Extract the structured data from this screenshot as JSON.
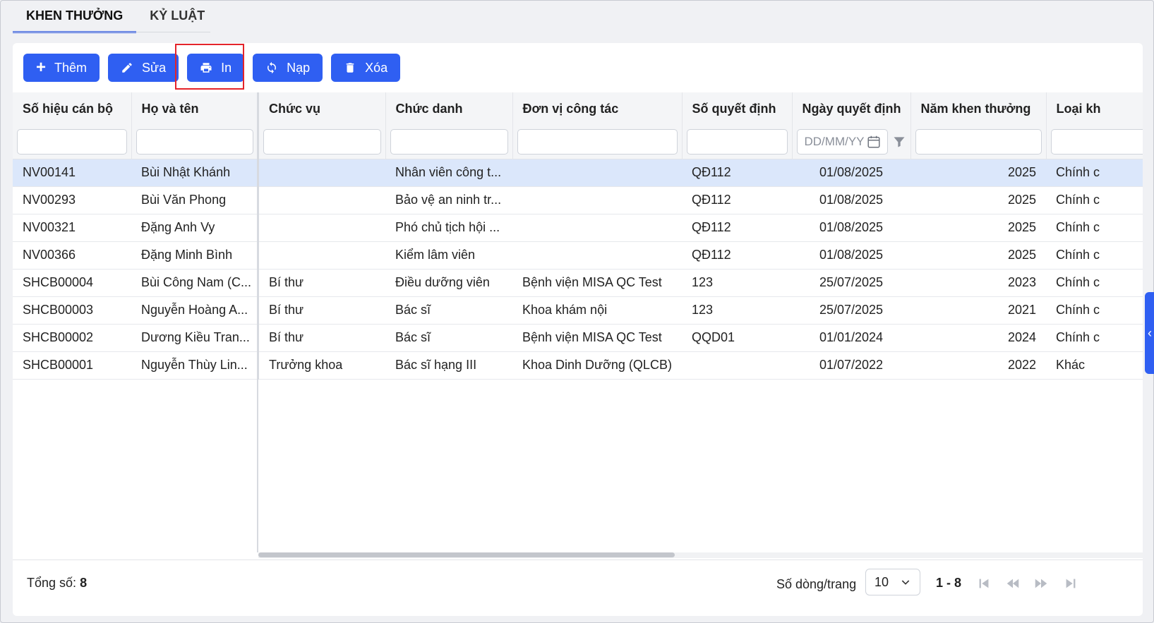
{
  "tabs": [
    {
      "label": "KHEN THƯỞNG"
    },
    {
      "label": "KỶ LUẬT"
    }
  ],
  "toolbar": {
    "add_label": "Thêm",
    "edit_label": "Sửa",
    "print_label": "In",
    "reload_label": "Nạp",
    "delete_label": "Xóa"
  },
  "columns": [
    "Số hiệu cán bộ",
    "Họ và tên",
    "Chức vụ",
    "Chức danh",
    "Đơn vị công tác",
    "Số quyết định",
    "Ngày quyết định",
    "Năm khen thưởng",
    "Loại kh"
  ],
  "filters": {
    "date_placeholder": "DD/MM/YY"
  },
  "rows": [
    {
      "code": "NV00141",
      "name": "Bùi Nhật Khánh",
      "position": "",
      "title": "Nhân viên công t...",
      "unit": "",
      "decision": "QĐ112",
      "date": "01/08/2025",
      "year": "2025",
      "type": "Chính c"
    },
    {
      "code": "NV00293",
      "name": "Bùi Văn Phong",
      "position": "",
      "title": "Bảo vệ an ninh tr...",
      "unit": "",
      "decision": "QĐ112",
      "date": "01/08/2025",
      "year": "2025",
      "type": "Chính c"
    },
    {
      "code": "NV00321",
      "name": "Đặng Anh Vy",
      "position": "",
      "title": "Phó chủ tịch hội ...",
      "unit": "",
      "decision": "QĐ112",
      "date": "01/08/2025",
      "year": "2025",
      "type": "Chính c"
    },
    {
      "code": "NV00366",
      "name": "Đặng Minh Bình",
      "position": "",
      "title": "Kiểm lâm viên",
      "unit": "",
      "decision": "QĐ112",
      "date": "01/08/2025",
      "year": "2025",
      "type": "Chính c"
    },
    {
      "code": "SHCB00004",
      "name": "Bùi Công Nam (C...",
      "position": "Bí thư",
      "title": "Điều dưỡng viên",
      "unit": "Bệnh viện MISA QC Test",
      "decision": "123",
      "date": "25/07/2025",
      "year": "2023",
      "type": "Chính c"
    },
    {
      "code": "SHCB00003",
      "name": "Nguyễn Hoàng A...",
      "position": "Bí thư",
      "title": "Bác sĩ",
      "unit": "Khoa khám nội",
      "decision": "123",
      "date": "25/07/2025",
      "year": "2021",
      "type": "Chính c"
    },
    {
      "code": "SHCB00002",
      "name": "Dương Kiều Tran...",
      "position": "Bí thư",
      "title": "Bác sĩ",
      "unit": "Bệnh viện MISA QC Test",
      "decision": "QQD01",
      "date": "01/01/2024",
      "year": "2024",
      "type": "Chính c"
    },
    {
      "code": "SHCB00001",
      "name": "Nguyễn Thùy Lin...",
      "position": "Trưởng khoa",
      "title": "Bác sĩ hạng III",
      "unit": "Khoa Dinh Dưỡng (QLCB)",
      "decision": "",
      "date": "01/07/2022",
      "year": "2022",
      "type": "Khác"
    }
  ],
  "footer": {
    "total_label": "Tổng số:",
    "total_value": "8",
    "rows_per_page_label": "Số dòng/trang",
    "rows_per_page_value": "10",
    "range": "1 - 8"
  },
  "colors": {
    "primary": "#2f5ff2",
    "selected_row": "#dbe7fb",
    "highlight_border": "#e4242a"
  }
}
